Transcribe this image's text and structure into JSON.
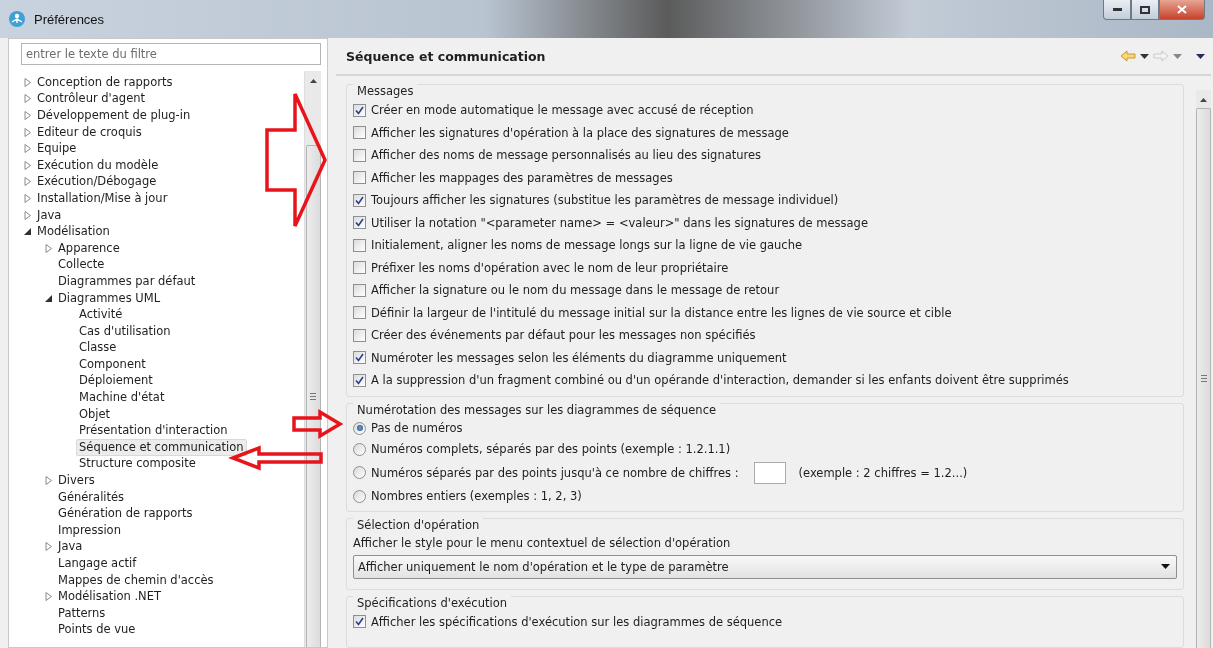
{
  "window": {
    "title": "Préférences"
  },
  "filter": {
    "placeholder": "entrer le texte du filtre"
  },
  "tree": [
    {
      "label": "Conception de rapports",
      "expanded": false,
      "selected": false
    },
    {
      "label": "Contrôleur d'agent",
      "expanded": false,
      "selected": false
    },
    {
      "label": "Développement de plug-in",
      "expanded": false,
      "selected": false
    },
    {
      "label": "Editeur de croquis",
      "expanded": false,
      "selected": false
    },
    {
      "label": "Equipe",
      "expanded": false,
      "selected": false
    },
    {
      "label": "Exécution du modèle",
      "expanded": false,
      "selected": false
    },
    {
      "label": "Exécution/Débogage",
      "expanded": false,
      "selected": false
    },
    {
      "label": "Installation/Mise à jour",
      "expanded": false,
      "selected": false
    },
    {
      "label": "Java",
      "expanded": false,
      "selected": false
    },
    {
      "label": "Modélisation",
      "expanded": true,
      "selected": false,
      "children": [
        {
          "label": "Apparence",
          "expanded": false,
          "selected": false
        },
        {
          "label": "Collecte",
          "selected": false
        },
        {
          "label": "Diagrammes par défaut",
          "selected": false
        },
        {
          "label": "Diagrammes UML",
          "expanded": true,
          "selected": false,
          "children": [
            {
              "label": "Activité",
              "selected": false
            },
            {
              "label": "Cas d'utilisation",
              "selected": false
            },
            {
              "label": "Classe",
              "selected": false
            },
            {
              "label": "Component",
              "selected": false
            },
            {
              "label": "Déploiement",
              "selected": false
            },
            {
              "label": "Machine d'état",
              "selected": false
            },
            {
              "label": "Objet",
              "selected": false
            },
            {
              "label": "Présentation d'interaction",
              "selected": false
            },
            {
              "label": "Séquence et communication",
              "selected": true
            },
            {
              "label": "Structure composite",
              "selected": false
            }
          ]
        },
        {
          "label": "Divers",
          "expanded": false,
          "selected": false
        },
        {
          "label": "Généralités",
          "selected": false
        },
        {
          "label": "Génération de rapports",
          "selected": false
        },
        {
          "label": "Impression",
          "selected": false
        },
        {
          "label": "Java",
          "expanded": false,
          "selected": false
        },
        {
          "label": "Langage actif",
          "selected": false
        },
        {
          "label": "Mappes de chemin d'accès",
          "selected": false
        },
        {
          "label": "Modélisation .NET",
          "expanded": false,
          "selected": false
        },
        {
          "label": "Patterns",
          "selected": false
        },
        {
          "label": "Points de vue",
          "selected": false
        }
      ]
    }
  ],
  "page": {
    "title": "Séquence et communication",
    "back_disabled": false,
    "forward_disabled": true
  },
  "messages": {
    "title": "Messages",
    "options": [
      {
        "label": "Créer en mode automatique le message avec accusé de réception",
        "checked": true
      },
      {
        "label": "Afficher les signatures d'opération à la place des signatures de message",
        "checked": false
      },
      {
        "label": "Afficher des noms de message personnalisés au lieu des signatures",
        "checked": false
      },
      {
        "label": "Afficher les mappages des paramètres de messages",
        "checked": false
      },
      {
        "label": "Toujours afficher les signatures (substitue les paramètres de message individuel)",
        "checked": true
      },
      {
        "label": "Utiliser la notation \"<parameter name> = <valeur>\" dans les signatures de message",
        "checked": true
      },
      {
        "label": "Initialement, aligner les noms de message longs sur la ligne de vie gauche",
        "checked": false
      },
      {
        "label": "Préfixer les noms d'opération avec le nom de leur propriétaire",
        "checked": false
      },
      {
        "label": "Afficher la signature ou le nom du message dans le message de retour",
        "checked": false
      },
      {
        "label": "Définir la largeur de l'intitulé du message initial sur la distance entre les lignes de vie source et cible",
        "checked": false
      },
      {
        "label": "Créer des événements par défaut pour les messages non spécifiés",
        "checked": false
      },
      {
        "label": "Numéroter les messages selon les éléments du diagramme uniquement",
        "checked": true
      },
      {
        "label": "A la suppression d'un fragment combiné ou d'un opérande d'interaction, demander si les enfants doivent être supprimés",
        "checked": true
      }
    ]
  },
  "numbering": {
    "title": "Numérotation des messages sur les diagrammes de séquence",
    "options": [
      {
        "label": "Pas de numéros",
        "kind": "plain",
        "selected": true
      },
      {
        "label": "Numéros complets, séparés par des points (exemple : 1.2.1.1)",
        "kind": "plain",
        "selected": false
      },
      {
        "label": "Numéros séparés par des points jusqu'à ce nombre de chiffres :",
        "kind": "field",
        "suffix": "(exemple : 2 chiffres = 1.2...)",
        "selected": false
      },
      {
        "label": "Nombres entiers (exemples : 1, 2, 3)",
        "kind": "plain",
        "selected": false
      }
    ]
  },
  "operation": {
    "title": "Sélection d'opération",
    "label": "Afficher le style pour le menu contextuel de sélection d'opération",
    "value": "Afficher uniquement le nom d'opération et le type de paramètre"
  },
  "execution": {
    "title": "Spécifications d'exécution",
    "options": [
      {
        "label": "Afficher les spécifications d'exécution sur les diagrammes de séquence",
        "checked": true
      }
    ]
  }
}
